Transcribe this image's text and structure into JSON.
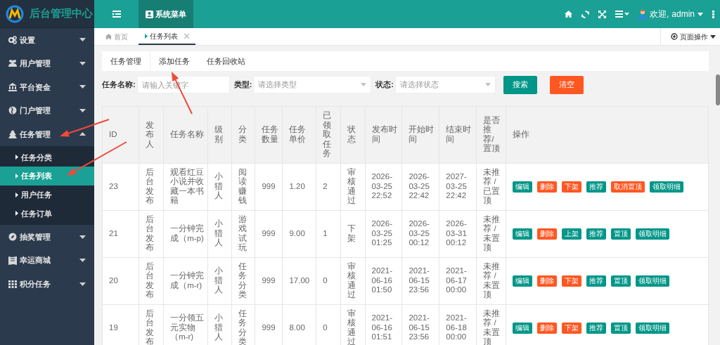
{
  "brand": {
    "title": "后台管理中心"
  },
  "header": {
    "tabs": [
      {
        "label": "系统菜单",
        "selected": true
      }
    ],
    "user": {
      "greeting": "欢迎,",
      "name": "admin"
    }
  },
  "sidebar": {
    "items": [
      {
        "label": "设置",
        "expanded": false
      },
      {
        "label": "用户管理",
        "expanded": false
      },
      {
        "label": "平台资金",
        "expanded": false
      },
      {
        "label": "门户管理",
        "expanded": false
      },
      {
        "label": "任务管理",
        "expanded": true,
        "children": [
          {
            "label": "任务分类",
            "selected": false
          },
          {
            "label": "任务列表",
            "selected": true
          },
          {
            "label": "用户任务",
            "selected": false
          },
          {
            "label": "任务订单",
            "selected": false
          }
        ]
      },
      {
        "label": "抽奖管理",
        "expanded": false
      },
      {
        "label": "幸运商城",
        "expanded": false
      },
      {
        "label": "积分任务",
        "expanded": false
      }
    ]
  },
  "page_tabs": [
    {
      "label": "首页",
      "selected": false,
      "closable": false
    },
    {
      "label": "任务列表",
      "selected": true,
      "closable": true
    }
  ],
  "page_actions": {
    "label": "页面操作"
  },
  "sub_tabs": [
    {
      "label": "任务管理",
      "selected": true
    },
    {
      "label": "添加任务",
      "selected": false
    },
    {
      "label": "任务回收站",
      "selected": false
    }
  ],
  "filters": [
    {
      "label": "任务名称:",
      "kind": "input",
      "placeholder": "请输入关键字"
    },
    {
      "label": "类型:",
      "kind": "select",
      "placeholder": "请选择类型"
    },
    {
      "label": "状态:",
      "kind": "select",
      "placeholder": "请选择状态"
    }
  ],
  "filter_buttons": [
    {
      "label": "搜索",
      "kind": "primary"
    },
    {
      "label": "清空",
      "kind": "danger"
    }
  ],
  "table": {
    "columns": [
      "ID",
      "发布人",
      "任务名称",
      "级别",
      "分类",
      "任务数量",
      "任务单价",
      "已领取任务",
      "状态",
      "发布时间",
      "开始时间",
      "结束时间",
      "是否推荐/置顶",
      "操作"
    ],
    "rows": [
      {
        "cells": [
          "23",
          "后台发布",
          "观看红豆小说并收藏一本书籍",
          "小猎人",
          "阅读赚钱",
          "999",
          "1.20",
          "2",
          "审核通过",
          "2026-03-25 22:52",
          "2026-03-25 22:42",
          "2027-03-25 22:42",
          "未推荐 / 已置顶"
        ],
        "actions": [
          {
            "label": "编辑",
            "kind": "primary"
          },
          {
            "label": "删除",
            "kind": "danger"
          },
          {
            "label": "下架",
            "kind": "danger"
          },
          {
            "label": "推荐",
            "kind": "primary"
          },
          {
            "label": "取消置顶",
            "kind": "danger"
          },
          {
            "label": "领取明细",
            "kind": "primary"
          }
        ]
      },
      {
        "cells": [
          "21",
          "后台发布",
          "一分钟完成（m-p)",
          "小猎人",
          "游戏试玩",
          "999",
          "9.00",
          "1",
          "下架",
          "2026-03-25 01:25",
          "2026-03-25 00:12",
          "2026-03-31 00:12",
          "未推荐 / 未置顶"
        ],
        "actions": [
          {
            "label": "编辑",
            "kind": "primary"
          },
          {
            "label": "删除",
            "kind": "danger"
          },
          {
            "label": "上架",
            "kind": "primary"
          },
          {
            "label": "推荐",
            "kind": "primary"
          },
          {
            "label": "置顶",
            "kind": "primary"
          },
          {
            "label": "领取明细",
            "kind": "primary"
          }
        ]
      },
      {
        "cells": [
          "20",
          "后台发布",
          "一分钟完成（m-r)",
          "小猎人",
          "任务分类",
          "999",
          "17.00",
          "0",
          "审核通过",
          "2021-06-16 01:50",
          "2021-06-15 23:56",
          "2021-06-17 00:00",
          "未推荐 / 未置顶"
        ],
        "actions": [
          {
            "label": "编辑",
            "kind": "primary"
          },
          {
            "label": "删除",
            "kind": "danger"
          },
          {
            "label": "下架",
            "kind": "danger"
          },
          {
            "label": "推荐",
            "kind": "primary"
          },
          {
            "label": "置顶",
            "kind": "primary"
          },
          {
            "label": "领取明细",
            "kind": "primary"
          }
        ]
      },
      {
        "cells": [
          "19",
          "后台发布",
          "一分领五元实物（m-r)",
          "小猎人",
          "任务分类",
          "999",
          "8.00",
          "0",
          "审核通过",
          "2021-06-16 01:51",
          "2021-06-15 23:56",
          "2021-06-18 00:00",
          "未推荐 / 未置顶"
        ],
        "actions": [
          {
            "label": "编辑",
            "kind": "primary"
          },
          {
            "label": "删除",
            "kind": "danger"
          },
          {
            "label": "下架",
            "kind": "danger"
          },
          {
            "label": "推荐",
            "kind": "primary"
          },
          {
            "label": "置顶",
            "kind": "primary"
          },
          {
            "label": "领取明细",
            "kind": "primary"
          }
        ]
      }
    ]
  }
}
